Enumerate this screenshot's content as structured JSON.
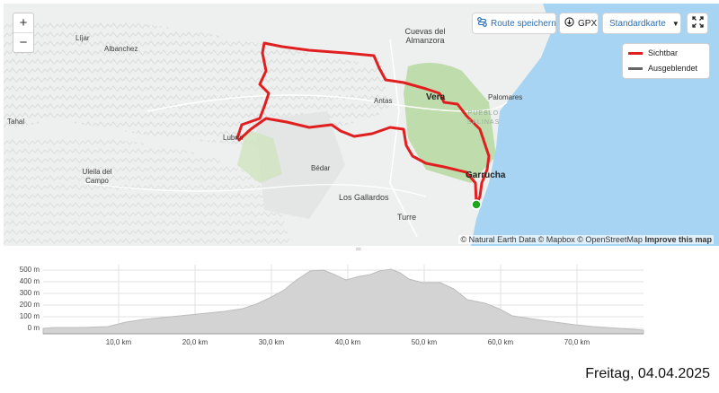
{
  "map": {
    "zoom_in_label": "+",
    "zoom_out_label": "−",
    "controls": {
      "save_route_label": "Route speichern",
      "gpx_label": "GPX",
      "map_style_label": "Standardkarte",
      "fullscreen_icon": "fullscreen-icon"
    },
    "legend": {
      "items": [
        {
          "label": "Sichtbar",
          "color": "#e02020"
        },
        {
          "label": "Ausgeblendet",
          "color": "#666666"
        }
      ]
    },
    "places": {
      "cuevas_line1": "Cuevas del",
      "cuevas_line2": "Almanzora",
      "lijar": "Líjar",
      "albanchez": "Albanchez",
      "tahal": "Tahal",
      "lubrin": "Lubrín",
      "antas": "Antas",
      "vera": "Vera",
      "palomares": "Palomares",
      "pueblo_line1": "PUEBLO",
      "pueblo_line2": "SALINAS",
      "uleila_line1": "Uleila del",
      "uleila_line2": "Campo",
      "bedar": "Bédar",
      "garrucha": "Garrucha",
      "los_gallardos": "Los Gallardos",
      "turre": "Turre"
    },
    "attribution": {
      "text": "© Natural Earth Data © Mapbox © OpenStreetMap",
      "improve": "Improve this map"
    },
    "colors": {
      "route": "#e02020",
      "sea": "#a7d4f2",
      "green": "#b6d9a0",
      "start_marker": "#1fa61f"
    }
  },
  "elevation_profile": {
    "y_ticks": [
      "500 m",
      "400 m",
      "300 m",
      "200 m",
      "100 m",
      "0 m"
    ],
    "x_ticks": [
      "10,0 km",
      "20,0 km",
      "30,0 km",
      "40,0 km",
      "50,0 km",
      "60,0 km",
      "70,0 km"
    ]
  },
  "footer": {
    "date": "Freitag, 04.04.2025"
  }
}
